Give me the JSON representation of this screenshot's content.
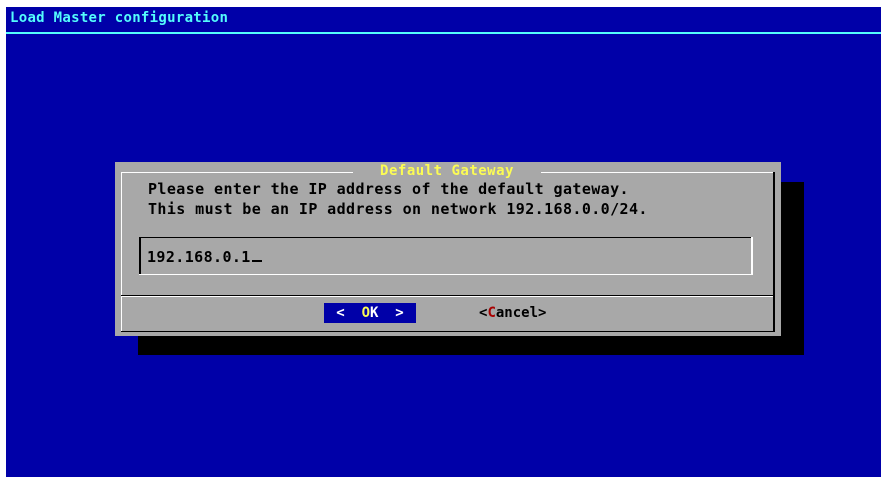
{
  "backtitle": "Load Master configuration",
  "dialog": {
    "title": "Default Gateway",
    "prompt_line1": "Please enter the IP address of the default gateway.",
    "prompt_line2": "This must be an IP address on network 192.168.0.0/24.",
    "input_value": "192.168.0.1"
  },
  "buttons": {
    "ok": {
      "left": "<  ",
      "hotkey": "O",
      "rest": "K",
      "right": "  >"
    },
    "cancel": {
      "left": "<",
      "hotkey": "C",
      "rest": "ancel",
      "right": ">"
    }
  },
  "colors": {
    "background": "#0000a8",
    "backtitle": "#54fcfc",
    "dialog": "#a8a8a8",
    "dialog_title": "#fcfc54",
    "hotkey_selected": "#fcfc54",
    "hotkey_unselected": "#a80000"
  }
}
